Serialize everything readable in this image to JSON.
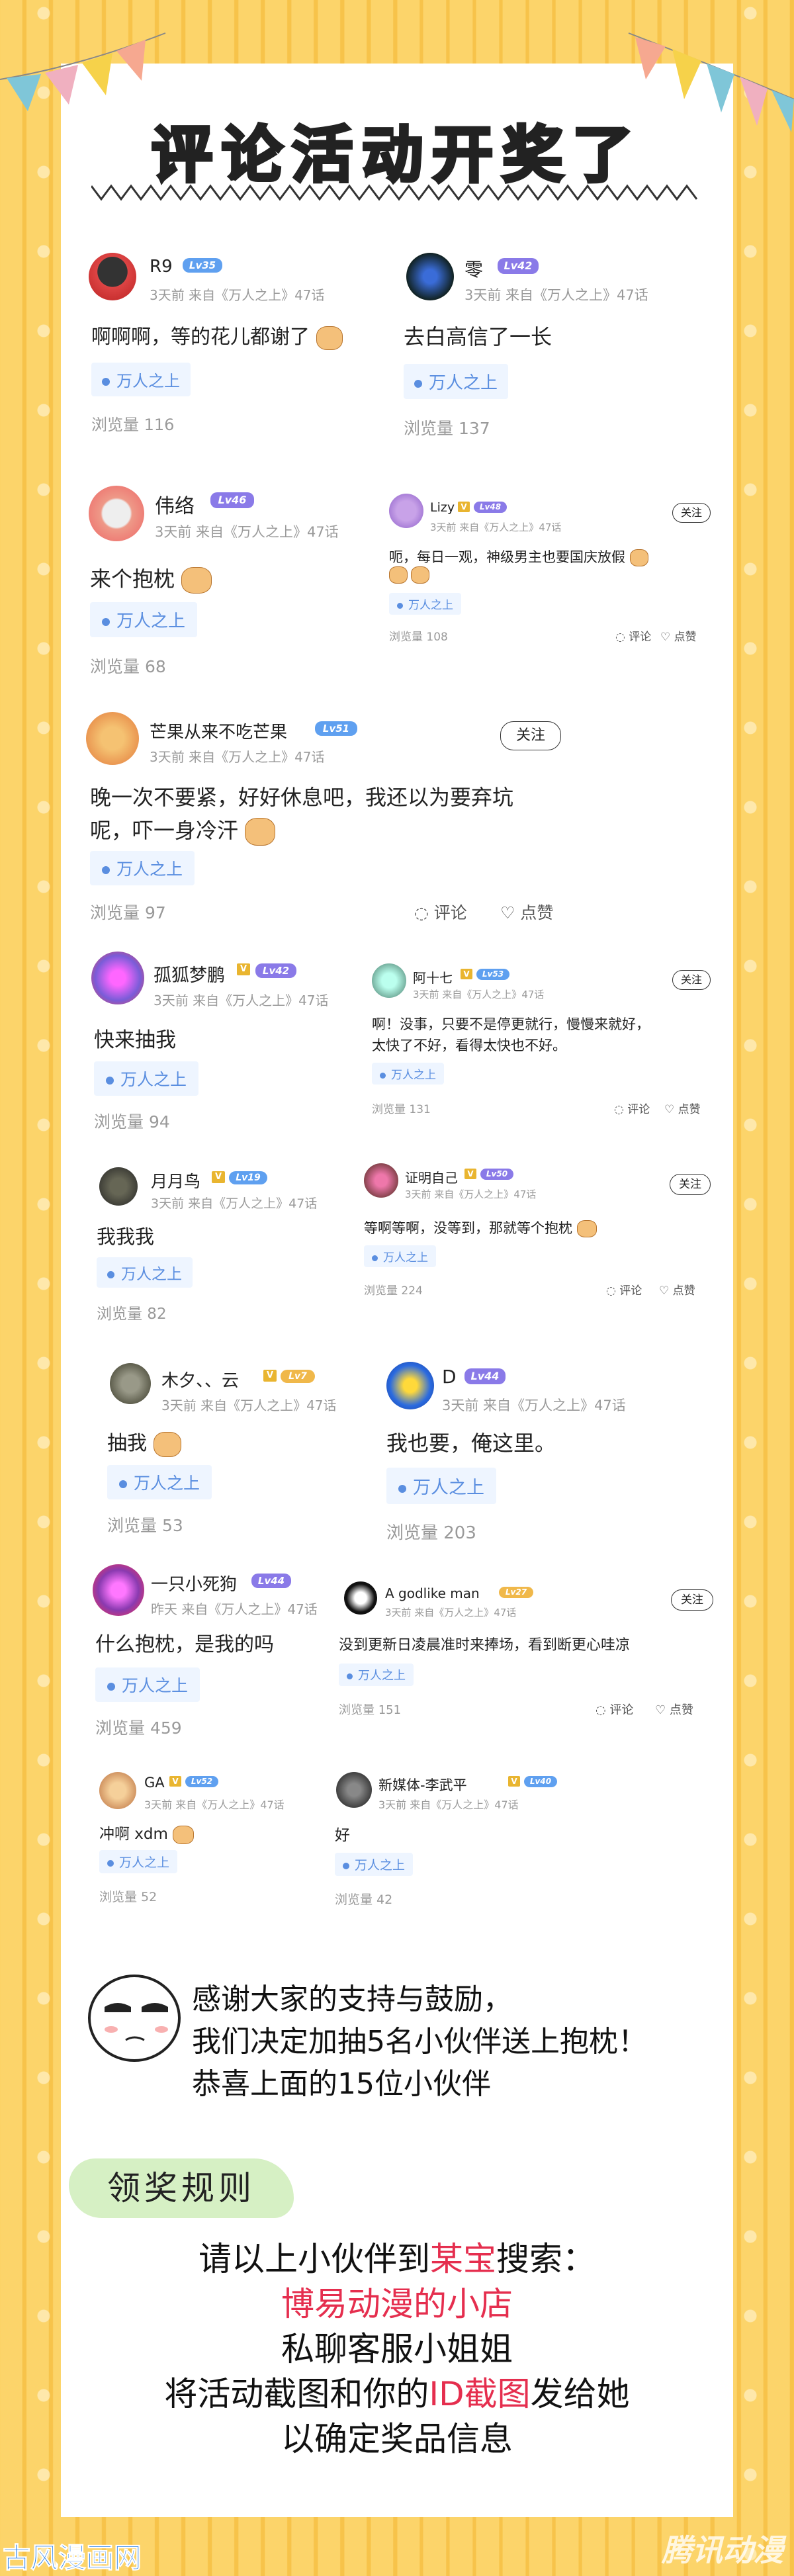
{
  "header": {
    "title": "评论活动开奖了"
  },
  "comments": [
    {
      "name": "R9",
      "level": "Lv35",
      "level_style": "blue",
      "time": "3天前 来自《万人之上》47话",
      "text": "啊啊啊，等的花儿都谢了",
      "tag": "万人之上",
      "views": "浏览量 116"
    },
    {
      "name": "零",
      "level": "Lv42",
      "level_style": "purple",
      "time": "3天前 来自《万人之上》47话",
      "text": "去白高信了一长",
      "tag": "万人之上",
      "views": "浏览量 137"
    },
    {
      "name": "伟络",
      "level": "Lv46",
      "level_style": "purple",
      "time": "3天前 来自《万人之上》47话",
      "text": "来个抱枕",
      "tag": "万人之上",
      "views": "浏览量 68"
    },
    {
      "name": "Lizy",
      "level": "Lv48",
      "level_style": "purple",
      "time": "3天前 来自《万人之上》47话",
      "text": "呃，每日一观，神级男主也要国庆放假",
      "tag": "万人之上",
      "views": "浏览量 108",
      "follow": "关注",
      "comment": "评论",
      "like": "点赞"
    },
    {
      "name": "芒果从来不吃芒果",
      "level": "Lv51",
      "level_style": "blue",
      "time": "3天前 来自《万人之上》47话",
      "text": "晚一次不要紧，好好休息吧，我还以为要弃坑",
      "text2": "呢，吓一身冷汗",
      "tag": "万人之上",
      "views": "浏览量 97",
      "follow": "关注",
      "comment": "评论",
      "like": "点赞"
    },
    {
      "name": "孤狐梦鹏",
      "level": "Lv42",
      "level_style": "purple",
      "time": "3天前 来自《万人之上》47话",
      "text": "快来抽我",
      "tag": "万人之上",
      "views": "浏览量 94"
    },
    {
      "name": "阿十七",
      "level": "Lv53",
      "level_style": "blue",
      "time": "3天前 来自《万人之上》47话",
      "text": "啊！没事，只要不是停更就行，慢慢来就好，",
      "text2": "太快了不好，看得太快也不好。",
      "tag": "万人之上",
      "views": "浏览量 131",
      "follow": "关注",
      "comment": "评论",
      "like": "点赞"
    },
    {
      "name": "月月鸟",
      "level": "Lv19",
      "level_style": "blue",
      "time": "3天前 来自《万人之上》47话",
      "text": "我我我",
      "tag": "万人之上",
      "views": "浏览量 82"
    },
    {
      "name": "证明自己",
      "level": "Lv50",
      "level_style": "purple",
      "time": "3天前 来自《万人之上》47话",
      "text": "等啊等啊，没等到，那就等个抱枕",
      "tag": "万人之上",
      "views": "浏览量 224",
      "follow": "关注",
      "comment": "评论",
      "like": "点赞"
    },
    {
      "name": "木夕、、云",
      "level": "Lv7",
      "level_style": "gold",
      "time": "3天前 来自《万人之上》47话",
      "text": "抽我",
      "tag": "万人之上",
      "views": "浏览量 53"
    },
    {
      "name": "D",
      "level": "Lv44",
      "level_style": "purple",
      "time": "3天前 来自《万人之上》47话",
      "text": "我也要，俺这里。",
      "tag": "万人之上",
      "views": "浏览量 203"
    },
    {
      "name": "一只小死狗",
      "level": "Lv44",
      "level_style": "purple",
      "time": "昨天 来自《万人之上》47话",
      "text": "什么抱枕，是我的吗",
      "tag": "万人之上",
      "views": "浏览量 459"
    },
    {
      "name": "A godlike man",
      "level": "Lv27",
      "level_style": "gold",
      "time": "3天前 来自《万人之上》47话",
      "text": "没到更新日凌晨准时来捧场，看到断更心哇凉",
      "tag": "万人之上",
      "views": "浏览量 151",
      "follow": "关注",
      "comment": "评论",
      "like": "点赞"
    },
    {
      "name": "GA",
      "level": "Lv52",
      "level_style": "blue",
      "time": "3天前 来自《万人之上》47话",
      "text": "冲啊 xdm",
      "tag": "万人之上",
      "views": "浏览量 52"
    },
    {
      "name": "新媒体-李武平",
      "level": "Lv40",
      "level_style": "blue",
      "time": "3天前 来自《万人之上》47话",
      "text": "好",
      "tag": "万人之上",
      "views": "浏览量 42"
    }
  ],
  "thanks": {
    "line1": "感谢大家的支持与鼓励，",
    "line2": "我们决定加抽5名小伙伴送上抱枕！",
    "line3": "恭喜上面的15位小伙伴"
  },
  "rules": {
    "header": "领奖规则",
    "l1_a": "请以上小伙伴到",
    "l1_b": "某宝",
    "l1_c": "搜索：",
    "l2": "博易动漫的小店",
    "l3": "私聊客服小姐姐",
    "l4_a": "将活动截图和你的",
    "l4_b": "ID截图",
    "l4_c": "发给她",
    "l5": "以确定奖品信息"
  },
  "watermarks": {
    "left": "古风漫画网",
    "right": "腾讯动漫"
  },
  "colors": {
    "accent_red": "#e52e4e",
    "tag_blue": "#5a8ee0",
    "background_yellow": "#fcd46a"
  }
}
